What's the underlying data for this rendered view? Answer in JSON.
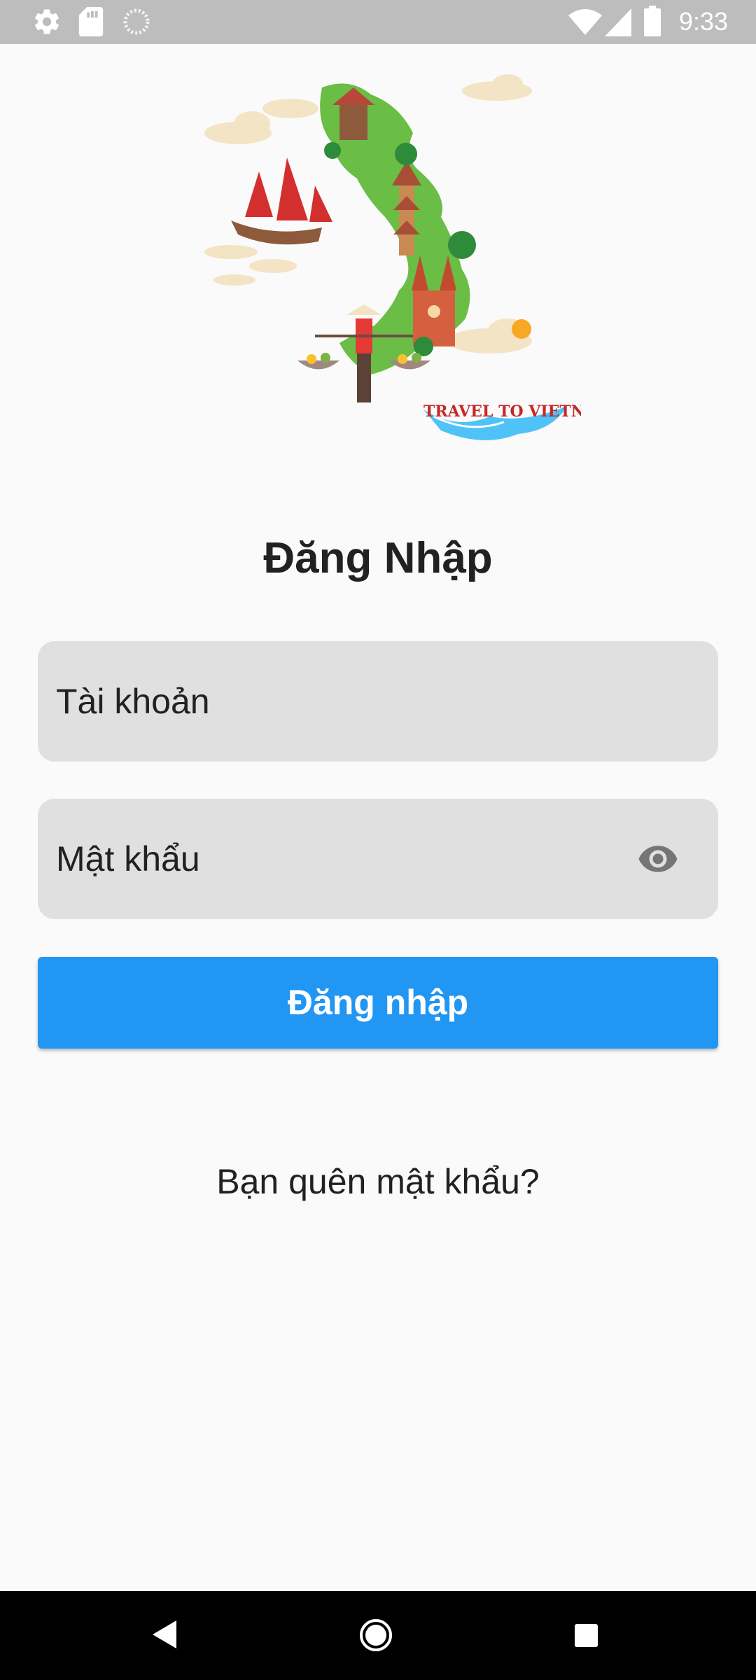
{
  "status_bar": {
    "time": "9:33",
    "icons": [
      "settings-icon",
      "sd-card-icon",
      "loading-icon",
      "wifi-icon",
      "signal-icon",
      "battery-icon"
    ]
  },
  "illustration": {
    "caption": "TRAVEL TO VIETNAM"
  },
  "login": {
    "title": "Đăng Nhập",
    "username_placeholder": "Tài khoản",
    "password_placeholder": "Mật khẩu",
    "submit_label": "Đăng nhập",
    "forgot_label": "Bạn quên mật khẩu?"
  },
  "nav_bar": {
    "icons": [
      "back-icon",
      "home-icon",
      "recents-icon"
    ]
  },
  "colors": {
    "primary": "#2196f3",
    "field_bg": "#e0e0e0",
    "status_bar": "#bdbdbd",
    "background": "#fafafa"
  }
}
